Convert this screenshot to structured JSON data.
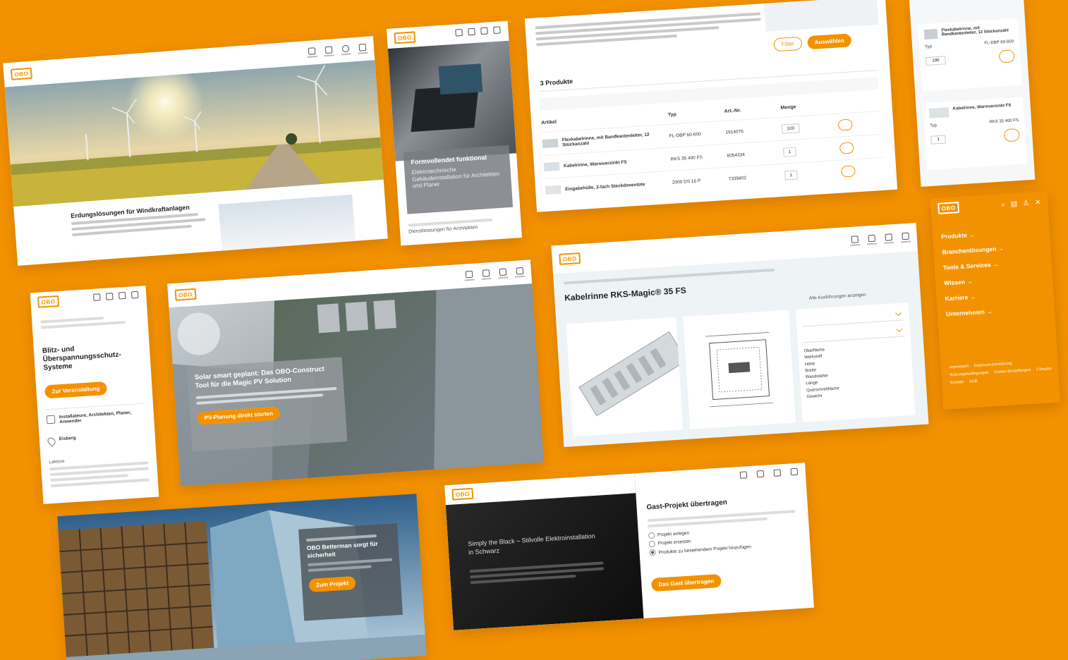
{
  "background_color": "#f39200",
  "accent_color": "#f39200",
  "logo_text": "OBO",
  "cards": {
    "wind": {
      "title": "Erdungslösungen für Windkraftanlagen"
    },
    "architect": {
      "overlay_title": "Formvollendet funktional",
      "overlay_text": "Elektrotechnische Gebäudeinstallation für Architekten und Planer",
      "subtext": "Dienstleistungen für Architekten"
    },
    "products": {
      "section_title": "3 Produkte",
      "filter_button": "Filter",
      "apply_button": "Auswählen",
      "columns": [
        "Artikel",
        "Typ",
        "Art.-Nr.",
        "Menge"
      ],
      "rows": [
        {
          "name": "Flexkabelrinne, mit Bandkantenleiter, 12 Stückanzahl",
          "type": "FL-DBP 60-600",
          "artno": "1914076",
          "qty": "100"
        },
        {
          "name": "Kabelrinne, Warmverzinkt FS",
          "type": "RKS 35 400 FS",
          "artno": "6054334",
          "qty": "1"
        },
        {
          "name": "Eingabehülle, 2-fach Steckdosentüte",
          "type": "2000 DS 16 P",
          "artno": "7339402",
          "qty": "1"
        }
      ]
    },
    "cart": {
      "items": [
        {
          "name": "Flexkabelrinne, mit Bandkantenleiter, 12 Stückanzahl",
          "type": "FL-DBP 60-600",
          "qty": "100"
        },
        {
          "name": "Kabelrinne, Warmverzinkt FS",
          "type": "RKS 35 400 FS",
          "qty": "1"
        }
      ],
      "label_type": "Typ"
    },
    "lightning": {
      "title": "Blitz- und Überspannungsschutz-Systeme",
      "button": "Zur Veranstaltung",
      "meta1": "Installateure, Architekten, Planer, Anwender",
      "meta2": "Eisberg",
      "section": "Lektüre"
    },
    "solar": {
      "headline": "Solar smart geplant: Das OBO-Construct Tool für die Magic PV Solution",
      "button": "PV-Planung direkt starten"
    },
    "product_detail": {
      "title": "Kabelrinne RKS-Magic® 35 FS",
      "link": "Alle Ausführungen anzeigen",
      "specs": [
        "Oberfläche",
        "Werkstoff",
        "Höhe",
        "Breite",
        "Wandstärke",
        "Länge",
        "Querschnittfläche",
        "Gewicht"
      ]
    },
    "menu": {
      "items": [
        "Produkte",
        "Branchenlösungen",
        "Tools & Services",
        "Wissen",
        "Karriere",
        "Unternehmen"
      ],
      "footer_links": [
        "Impressum",
        "Datenschutzerklärung",
        "Nutzungsbedingungen",
        "Cookie-Einstellungen",
        "Fahrplan",
        "Kontakt",
        "AGB"
      ]
    },
    "building": {
      "headline": "OBO Betterman sorgt für sicherheit",
      "button": "Zum Projekt"
    },
    "black": {
      "headline": "Simply the Black – Stilvolle Elektroinstallation in Schwarz",
      "form_title": "Gast-Projekt übertragen",
      "options": [
        "Projekt anlegen",
        "Projekt ersetzen",
        "Produkte zu bestehendem Projekt hinzufügen"
      ],
      "button": "Das Gast übertragen"
    }
  }
}
